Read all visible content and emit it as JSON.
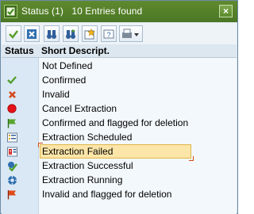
{
  "window": {
    "title": "Status (1)   10 Entries found",
    "close_label": "×"
  },
  "toolbar": {
    "buttons": [
      {
        "name": "confirm-check-icon"
      },
      {
        "name": "cancel-x-icon"
      },
      {
        "name": "find-binoculars-icon"
      },
      {
        "name": "find-next-binoculars-icon"
      },
      {
        "name": "favorite-star-icon"
      },
      {
        "name": "help-icon"
      },
      {
        "name": "print-layout-icon"
      }
    ]
  },
  "table": {
    "headers": {
      "status": "Status",
      "description": "Short Descript."
    },
    "rows": [
      {
        "icon": "none",
        "label": "Not Defined"
      },
      {
        "icon": "green-check-icon",
        "label": "Confirmed"
      },
      {
        "icon": "red-x-icon",
        "label": "Invalid"
      },
      {
        "icon": "red-dot-icon",
        "label": "Cancel Extraction"
      },
      {
        "icon": "green-flag-icon",
        "label": "Confirmed and flagged for deletion"
      },
      {
        "icon": "schedule-list-icon",
        "label": "Extraction Scheduled"
      },
      {
        "icon": "failed-warning-icon",
        "label": "Extraction Failed",
        "selected": true
      },
      {
        "icon": "success-check-icon",
        "label": "Extraction Successful"
      },
      {
        "icon": "running-gear-icon",
        "label": "Extraction Running"
      },
      {
        "icon": "red-flag-icon",
        "label": "Invalid and flagged for deletion"
      }
    ]
  },
  "colors": {
    "title_bg": "#4f7b27",
    "selection": "#fbe5a8",
    "status_column": "#d9e8f4"
  }
}
